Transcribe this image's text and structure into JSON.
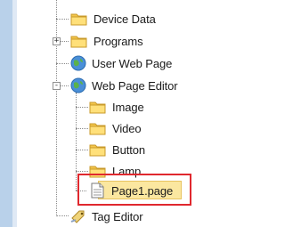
{
  "tree": {
    "items": [
      {
        "label": "Device Data",
        "icon": "folder-icon"
      },
      {
        "label": "Programs",
        "icon": "folder-icon",
        "expander": "+"
      },
      {
        "label": "User Web Page",
        "icon": "globe-icon"
      },
      {
        "label": "Web Page Editor",
        "icon": "globe-icon",
        "expander": "-"
      },
      {
        "label": "Image",
        "icon": "folder-icon"
      },
      {
        "label": "Video",
        "icon": "folder-icon"
      },
      {
        "label": "Button",
        "icon": "folder-icon"
      },
      {
        "label": "Lamp",
        "icon": "folder-icon"
      },
      {
        "label": "Page1.page",
        "icon": "page-icon",
        "selected": true
      },
      {
        "label": "Tag Editor",
        "icon": "tag-icon"
      }
    ]
  },
  "colors": {
    "highlight_border": "#e0282e",
    "selection_background": "#fbe7a0",
    "left_panel": "#b9d1ea"
  }
}
